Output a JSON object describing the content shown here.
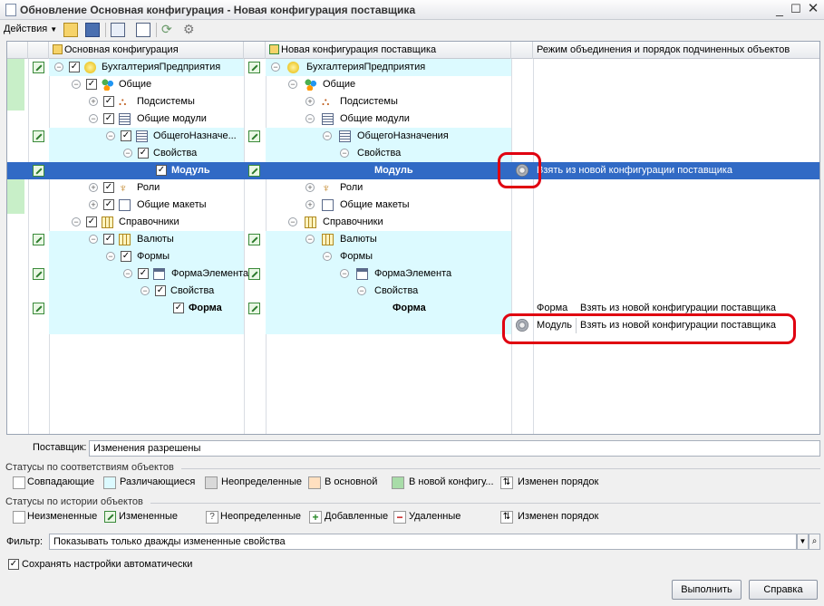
{
  "window": {
    "title": "Обновление Основная конфигурация - Новая конфигурация поставщика"
  },
  "toolbar": {
    "actions_label": "Действия"
  },
  "grid": {
    "headers": {
      "main": "Основная конфигурация",
      "vendor": "Новая конфигурация поставщика",
      "mode": "Режим объединения и порядок подчиненных объектов"
    },
    "rows": [
      {
        "left": "БухгалтерияПредприятия",
        "right": "БухгалтерияПредприятия",
        "mode": ""
      },
      {
        "left": "Общие",
        "right": "Общие",
        "mode": ""
      },
      {
        "left": "Подсистемы",
        "right": "Подсистемы",
        "mode": ""
      },
      {
        "left": "Общие модули",
        "right": "Общие модули",
        "mode": ""
      },
      {
        "left": "ОбщегоНазначе...",
        "right": "ОбщегоНазначения",
        "mode": ""
      },
      {
        "left": "Свойства",
        "right": "Свойства",
        "mode": ""
      },
      {
        "left": "Модуль",
        "right": "Модуль",
        "mode": "Взять из новой конфигурации поставщика"
      },
      {
        "left": "Роли",
        "right": "Роли",
        "mode": ""
      },
      {
        "left": "Общие макеты",
        "right": "Общие макеты",
        "mode": ""
      },
      {
        "left": "Справочники",
        "right": "Справочники",
        "mode": ""
      },
      {
        "left": "Валюты",
        "right": "Валюты",
        "mode": ""
      },
      {
        "left": "Формы",
        "right": "Формы",
        "mode": ""
      },
      {
        "left": "ФормаЭлемента...",
        "right": "ФормаЭлемента",
        "mode": ""
      },
      {
        "left": "Свойства",
        "right": "Свойства",
        "mode": ""
      },
      {
        "left": "Форма",
        "right": "Форма",
        "mode": ""
      }
    ],
    "sub_rows": [
      {
        "name": "Форма",
        "mode": "Взять из новой конфигурации поставщика"
      },
      {
        "name": "Модуль",
        "mode": "Взять из новой конфигурации поставщика"
      }
    ]
  },
  "vendor": {
    "label": "Поставщик:",
    "value": "Изменения разрешены"
  },
  "status_match": {
    "title": "Статусы по соответствиям объектов",
    "items": [
      {
        "label": "Совпадающие",
        "color": "#ffffff"
      },
      {
        "label": "Различающиеся",
        "color": "#dcfaff"
      },
      {
        "label": "Неопределенные",
        "color": "#d9d9d9"
      },
      {
        "label": "В основной",
        "color": "#ffe0c0"
      },
      {
        "label": "В новой конфигу...",
        "color": "#a8dca8"
      },
      {
        "label": "Изменен порядок",
        "color": "#ffffff"
      }
    ]
  },
  "status_history": {
    "title": "Статусы по истории объектов",
    "items": [
      {
        "label": "Неизмененные"
      },
      {
        "label": "Измененные"
      },
      {
        "label": "Неопределенные"
      },
      {
        "label": "Добавленные"
      },
      {
        "label": "Удаленные"
      },
      {
        "label": "Изменен порядок"
      }
    ]
  },
  "filter": {
    "label": "Фильтр:",
    "value": "Показывать только дважды измененные свойства"
  },
  "autosave": {
    "label": "Сохранять настройки автоматически",
    "checked": true
  },
  "buttons": {
    "run": "Выполнить",
    "help": "Справка"
  }
}
